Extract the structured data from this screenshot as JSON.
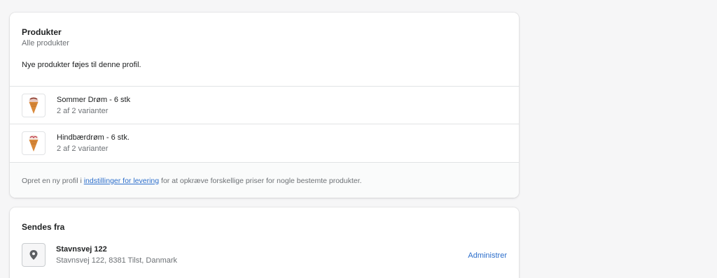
{
  "products_card": {
    "title": "Produkter",
    "subtitle": "Alle produkter",
    "note": "Nye produkter føjes til denne profil.",
    "items": [
      {
        "name": "Sommer Drøm - 6 stk",
        "variants": "2 af 2 varianter",
        "icon": "ice-cream-cone-icon"
      },
      {
        "name": "Hindbærdrøm - 6 stk.",
        "variants": "2 af 2 varianter",
        "icon": "ice-cream-cone-icon"
      }
    ],
    "footer": {
      "prefix": "Opret en ny profil i ",
      "link_text": "indstillinger for levering",
      "suffix": " for at opkræve forskellige priser for nogle bestemte produkter."
    }
  },
  "ships_from_card": {
    "title": "Sendes fra",
    "location_name": "Stavnsvej 122",
    "location_address": "Stavnsvej 122, 8381 Tilst, Danmark",
    "manage_label": "Administrer",
    "icon": "location-pin-icon"
  },
  "colors": {
    "background": "#f6f6f7",
    "link": "#2c6ecb",
    "subdued_text": "#6d7175"
  }
}
